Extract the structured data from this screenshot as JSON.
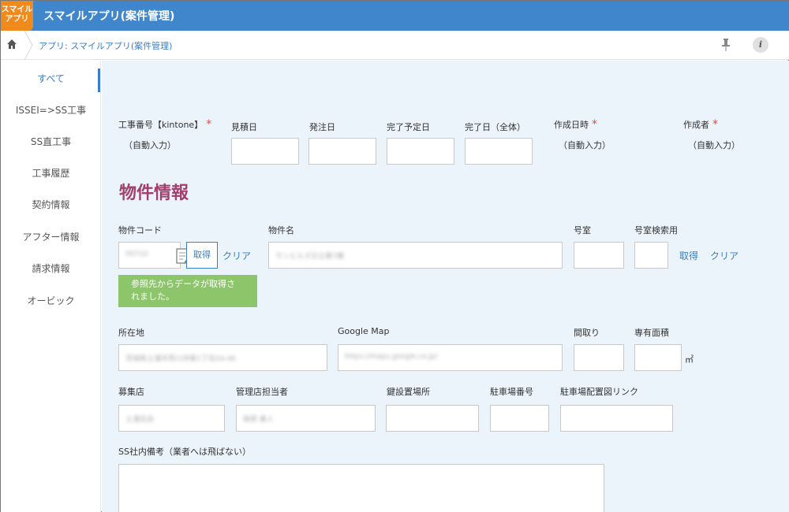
{
  "header": {
    "logo_text_line1": "スマイル",
    "logo_text_line2": "アプリ",
    "title": "スマイルアプリ(案件管理)"
  },
  "breadcrumb": {
    "app_path": "アプリ: スマイルアプリ(案件管理)"
  },
  "sidebar": {
    "items": [
      {
        "label": "すべて"
      },
      {
        "label": "ISSEI=>SS工事"
      },
      {
        "label": "SS直工事"
      },
      {
        "label": "工事履歴"
      },
      {
        "label": "契約情報"
      },
      {
        "label": "アフター情報"
      },
      {
        "label": "請求情報"
      },
      {
        "label": "オービック"
      }
    ]
  },
  "form": {
    "top_row": {
      "koji_no_label": "工事番号【kintone】",
      "koji_no_value": "（自動入力）",
      "mitsumori_label": "見積日",
      "hatchu_label": "発注日",
      "kanryo_yotei_label": "完了予定日",
      "kanryo_label": "完了日（全体）",
      "created_at_label": "作成日時",
      "created_at_value": "（自動入力）",
      "creator_label": "作成者",
      "creator_value": "（自動入力）"
    },
    "section_title": "物件情報",
    "property": {
      "code_label": "物件コード",
      "code_value": "00710",
      "fetch_button": "取得",
      "clear_link": "クリア",
      "name_label": "物件名",
      "name_value": "サンヒルズ日立第7棟",
      "room_label": "号室",
      "room_search_label": "号室検索用",
      "room_fetch_link": "取得",
      "room_clear_link": "クリア",
      "toast_line1": "参照先からデータが取得さ",
      "toast_line2": "れました。"
    },
    "location": {
      "address_label": "所在地",
      "address_value": "茨城県土浦市荒川沖東1丁目24-46",
      "map_label": "Google Map",
      "map_value": "https://maps.google.co.jp/",
      "madori_label": "間取り",
      "area_label": "専有面積",
      "area_unit": "㎡"
    },
    "agents": {
      "boshu_label": "募集店",
      "boshu_value": "土浦支店",
      "tanto_label": "管理店担当者",
      "tanto_value": "篠原 美人",
      "key_label": "鍵設置場所",
      "parking_no_label": "駐車場番号",
      "parking_link_label": "駐車場配置図リンク"
    },
    "notes": {
      "label": "SS社内備考（業者へは飛ばない）"
    }
  }
}
